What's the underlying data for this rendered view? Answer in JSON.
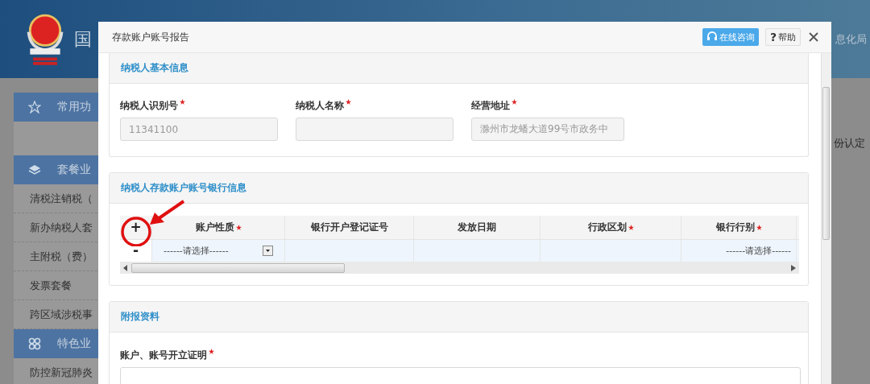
{
  "background": {
    "header_title": "国",
    "header_right": "息化局",
    "sidebar": [
      {
        "kind": "section",
        "label": "常用功"
      },
      {
        "kind": "blank"
      },
      {
        "kind": "section",
        "label": "套餐业"
      },
      {
        "kind": "item",
        "label": "清税注销税（"
      },
      {
        "kind": "item",
        "label": "新办纳税人套"
      },
      {
        "kind": "item",
        "label": "主附税（费）"
      },
      {
        "kind": "item",
        "label": "发票套餐"
      },
      {
        "kind": "item",
        "label": "跨区域涉税事"
      },
      {
        "kind": "section",
        "label": "特色业"
      },
      {
        "kind": "item",
        "label": "防控新冠肺炎"
      }
    ],
    "content_text": "份认定"
  },
  "dialog": {
    "title": "存款账户账号报告",
    "buttons": [
      {
        "kind": "consult",
        "label": "在线咨询"
      },
      {
        "kind": "help",
        "icon_text": "?",
        "label": "帮助"
      }
    ],
    "sections": [
      {
        "kind": "fields",
        "title": "纳税人基本信息",
        "fields": [
          {
            "label": "纳税人识别号",
            "required": true,
            "value": "11341100"
          },
          {
            "label": "纳税人名称",
            "required": true
          },
          {
            "label": "经营地址",
            "required": true,
            "value": "滁州市龙蟠大道99号市政务中"
          }
        ]
      },
      {
        "kind": "table",
        "title": "纳税人存款账户账号银行信息",
        "add": "+",
        "columns": [
          {
            "label": "账户性质",
            "required": true
          },
          {
            "label": "银行开户登记证号",
            "required": false
          },
          {
            "label": "发放日期",
            "required": false
          },
          {
            "label": "行政区划",
            "required": true
          },
          {
            "label": "银行行别",
            "required": true
          }
        ],
        "rows": [
          {
            "remove": "-",
            "cells": [
              {
                "kind": "select",
                "value": "------请选择------"
              },
              {
                "kind": "text"
              },
              {
                "kind": "text"
              },
              {
                "kind": "text"
              },
              {
                "kind": "text",
                "value": "------请选择------"
              }
            ]
          }
        ]
      },
      {
        "kind": "upload",
        "title": "附报资料",
        "fields": [
          {
            "label": "账户、账号开立证明",
            "required": true
          }
        ]
      }
    ]
  }
}
